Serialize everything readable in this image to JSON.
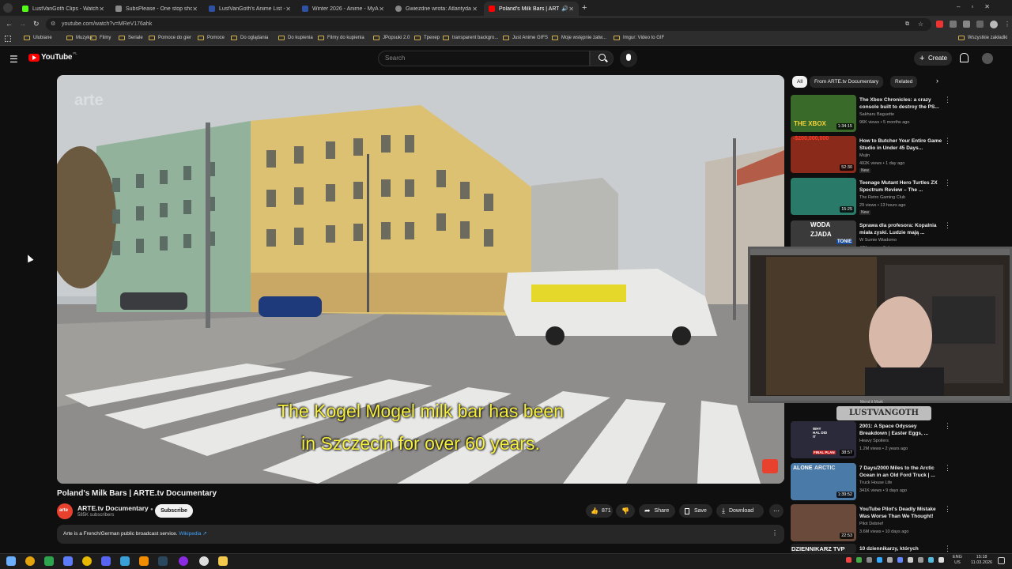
{
  "browser": {
    "tabs": [
      {
        "title": "LustVanGoth Clips - Watch Live",
        "color": "#53fc18"
      },
      {
        "title": "SubsPlease - One stop shop fo",
        "color": "#8a8a8a"
      },
      {
        "title": "LustVanGoth's Anime List - My",
        "color": "#2e51a2"
      },
      {
        "title": "Winter 2026 - Anime - MyAnim",
        "color": "#2e51a2"
      },
      {
        "title": "Gwiezdne wrota: Atlantyda / St",
        "color": "#888888"
      },
      {
        "title": "Poland's Milk Bars | ARTE.tv",
        "color": "#ff0000"
      }
    ],
    "url": "youtube.com/watch?v=MReV176ahk",
    "bookmarks": [
      "Ulubiane",
      "Muzyka",
      "Filmy",
      "Seriale",
      "Pomoce do gier",
      "Pomoce",
      "Do oglądania",
      "Do kupienia",
      "Filmy do kupienia",
      "JPopsuki 2.0",
      "Tpexep",
      "transparent backgro...",
      "Just Anime GIFS",
      "Moje wstępnie zatw...",
      "Imgur: Video to GIF"
    ],
    "all_bookmarks": "Wszystkie zakładki"
  },
  "youtube": {
    "logo": "YouTube",
    "logo_region": "PL",
    "search_placeholder": "Search",
    "create_label": "Create"
  },
  "video": {
    "subtitle_line1": "The Kogel Mogel milk bar has been",
    "subtitle_line2": "in Szczecin for over 60 years.",
    "title": "Poland's Milk Bars | ARTE.tv Documentary",
    "channel": "ARTE.tv Documentary",
    "subscribers": "585K subscribers",
    "subscribe_label": "Subscribe",
    "likes": "871",
    "share_label": "Share",
    "save_label": "Save",
    "download_label": "Download",
    "description": "Arte is a French/German public broadcast service.",
    "description_link": "Wikipedia ↗"
  },
  "sidebar": {
    "chips": [
      "All",
      "From ARTE.tv Documentary",
      "Related"
    ],
    "recommendations": [
      {
        "title": "The Xbox Chronicles: a crazy console built to destroy the PS...",
        "channel": "Sakharu Baguette",
        "meta": "96K views • 5 months ago",
        "duration": "1:34:15",
        "badge": "",
        "thumb": "#3a6a2a"
      },
      {
        "title": "How to Butcher Your Entire Game Studio in Under 45 Days...",
        "channel": "Mujin",
        "meta": "492K views • 1 day ago",
        "duration": "52:30",
        "badge": "New",
        "thumb": "#8a2a1a"
      },
      {
        "title": "Teenage Mutant Hero Turtles ZX Spectrum Review – The ...",
        "channel": "The Retro Gaming Club",
        "meta": "29 views • 13 hours ago",
        "duration": "15:25",
        "badge": "New",
        "thumb": "#2a7a6a"
      },
      {
        "title": "Sprawa dla profesora: Kopalnia miała zyski. Ludzie mają ...",
        "channel": "W Sumie Wiadomo",
        "meta": "47K views • 9 days ago",
        "duration": "",
        "badge": "",
        "thumb": "#3a3a3a"
      },
      {
        "title": "2001: A Space Odyssey Breakdown | Easter Eggs, ...",
        "channel": "Heavy Spoilers",
        "meta": "1.2M views • 2 years ago",
        "duration": "38:57",
        "badge": "",
        "thumb": "#2a2a3a"
      },
      {
        "title": "7 Days/2000 Miles to the Arctic Ocean in an Old Ford Truck | ...",
        "channel": "Truck House Life",
        "meta": "341K views • 9 days ago",
        "duration": "1:39:52",
        "badge": "",
        "thumb": "#4a7aa8"
      },
      {
        "title": "YouTube Pilot's Deadly Mistake Was Worse Than We Thought!",
        "channel": "Pilot Debrief",
        "meta": "3.6M views • 10 days ago",
        "duration": "22:53",
        "badge": "",
        "thumb": "#6a4a3a"
      },
      {
        "title": "10 dziennikarzy, których",
        "channel": "",
        "meta": "",
        "duration": "",
        "badge": "",
        "thumb": "#222222"
      }
    ]
  },
  "webcam": {
    "overlay_small": "Mend it Mark",
    "overlay_name": "LUSTVANGOTH"
  },
  "thumb_texts": {
    "xbox": "THE XBOX",
    "money": "-$200,000,000",
    "woda": "WODA",
    "zjada": "ZJADA",
    "tonie": "TONIE",
    "arctic": "ARCTIC",
    "final_plan": "FINAL PLAN",
    "why_hal": "WHY HAL DID IT",
    "alone": "ALONE",
    "dzien": "DZIENNIKARZ TVP"
  },
  "taskbar": {
    "lang": "ENG",
    "lang2": "US",
    "time": "15:18",
    "date": "11.03.2026"
  }
}
